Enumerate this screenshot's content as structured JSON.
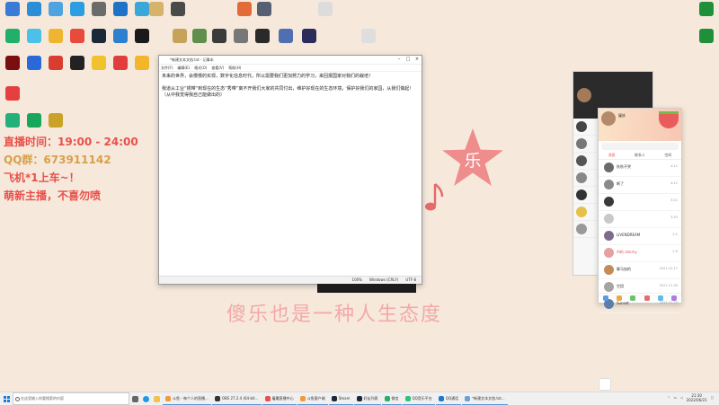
{
  "overlay": {
    "time_label": "直播时间：",
    "time_value": "19:00 - 24:00",
    "qq_label": "QQ群：",
    "qq_value": "673911142",
    "line3": "飞机*1上车~！",
    "line4": "萌新主播，不喜勿喷",
    "slogan": "傻乐也是一种人生态度",
    "star_char": "乐"
  },
  "notepad": {
    "title": "*新建文本文档.txt - 记事本",
    "menu": [
      "文件(F)",
      "编辑(E)",
      "格式(O)",
      "查看(V)",
      "帮助(H)"
    ],
    "paragraphs": [
      "未来的世界，会慢慢的实现，数字化信息时代，所以需要我们更加努力的学习，来回报国家对我们的栽培！",
      "我道从工业“锈带”到现在的生态“秀带”离不开我们大家的共同付出，维护好现在的生态环境，保护好我们的家园，从我们做起！（从中我觉得我自己能做出的）"
    ],
    "status": [
      "100%",
      "Windows (CRLF)",
      "UTF-8"
    ]
  },
  "chat": {
    "nickname": "屠妖",
    "tabs": [
      "消息",
      "联系人",
      "空间"
    ],
    "items": [
      {
        "name": "秋秋不哭",
        "time": "4:12"
      },
      {
        "name": "断了",
        "time": "4:11"
      },
      {
        "name": "",
        "time": "3:21"
      },
      {
        "name": "",
        "time": "3:25"
      },
      {
        "name": "LIVENDREAM",
        "time": "2:1"
      },
      {
        "name": "AI的 ahkmy",
        "time": "1:9"
      },
      {
        "name": "聊马加的",
        "time": "2021-12-17"
      },
      {
        "name": "空团",
        "time": "2021-11-30"
      },
      {
        "name": "Sunset",
        "time": "2021-11-23"
      }
    ]
  },
  "taskbar": {
    "search_placeholder": "在这里输入你要搜索的内容",
    "apps": [
      {
        "label": "斗鱼 - 每个人的直播...",
        "color": "#f29b38"
      },
      {
        "label": "OBS 27.2.4 (64-bit...",
        "color": "#333333"
      },
      {
        "label": "屠魔直播中心",
        "color": "#e8504b"
      },
      {
        "label": "斗鱼客户端",
        "color": "#f29b38"
      },
      {
        "label": "Steam",
        "color": "#1b2838"
      },
      {
        "label": "好友列表",
        "color": "#1b2838"
      },
      {
        "label": "微信",
        "color": "#2aae67"
      },
      {
        "label": "QQ音乐平台",
        "color": "#31c27c"
      },
      {
        "label": "QQ通话",
        "color": "#1e78d7"
      },
      {
        "label": "*新建文本文档.txt...",
        "color": "#6aa0d8"
      }
    ],
    "time": "21:30",
    "date": "2022/06/21"
  },
  "desktop_icons_left": [
    {
      "label": "",
      "color": "#3a7bd5"
    },
    {
      "label": "",
      "color": "#2c8ed6"
    },
    {
      "label": "",
      "color": "#4fa3e0"
    },
    {
      "label": "",
      "color": "#2b9de0"
    },
    {
      "label": "",
      "color": "#6b6b6b"
    },
    {
      "label": "",
      "color": "#1e73c8"
    },
    {
      "label": "",
      "color": "#3aa7d8"
    },
    {
      "label": "",
      "color": "#21b06a"
    },
    {
      "label": "",
      "color": "#4bc0e8"
    },
    {
      "label": "",
      "color": "#f0b530"
    },
    {
      "label": "",
      "color": "#e84a3b"
    },
    {
      "label": "",
      "color": "#1b2838"
    },
    {
      "label": "",
      "color": "#2d7fd0"
    },
    {
      "label": "",
      "color": "#1a1a1a"
    },
    {
      "label": "",
      "color": "#7a0f0f"
    },
    {
      "label": "",
      "color": "#2a6ad8"
    },
    {
      "label": "",
      "color": "#d93d2f"
    },
    {
      "label": "",
      "color": "#222222"
    },
    {
      "label": "",
      "color": "#f2c12e"
    },
    {
      "label": "",
      "color": "#e23d3d"
    },
    {
      "label": "",
      "color": "#f3b62a"
    },
    {
      "label": "",
      "color": "#e53f3f"
    },
    {
      "label": "",
      "color": "#24b07a"
    },
    {
      "label": "",
      "color": "#18a65b"
    },
    {
      "label": "",
      "color": "#c9a227"
    }
  ],
  "desktop_icons_top": [
    {
      "label": "",
      "color": "#d6b26b"
    },
    {
      "label": "",
      "color": "#4a4a4a"
    },
    {
      "label": "",
      "color": "#e26b3a"
    },
    {
      "label": "",
      "color": "#566072"
    },
    {
      "label": "",
      "color": "#dcdcdc"
    },
    {
      "label": "",
      "color": "#c7a35a"
    },
    {
      "label": "",
      "color": "#5f8f4a"
    },
    {
      "label": "",
      "color": "#3b3b3b"
    },
    {
      "label": "",
      "color": "#777777"
    },
    {
      "label": "",
      "color": "#2a2a2a"
    },
    {
      "label": "",
      "color": "#4f6fb0"
    },
    {
      "label": "",
      "color": "#2c2c5a"
    },
    {
      "label": "",
      "color": "#dedede"
    }
  ],
  "desktop_icons_right": [
    {
      "label": "",
      "color": "#1f8f3a"
    },
    {
      "label": "",
      "color": "#1f8f3a"
    }
  ]
}
